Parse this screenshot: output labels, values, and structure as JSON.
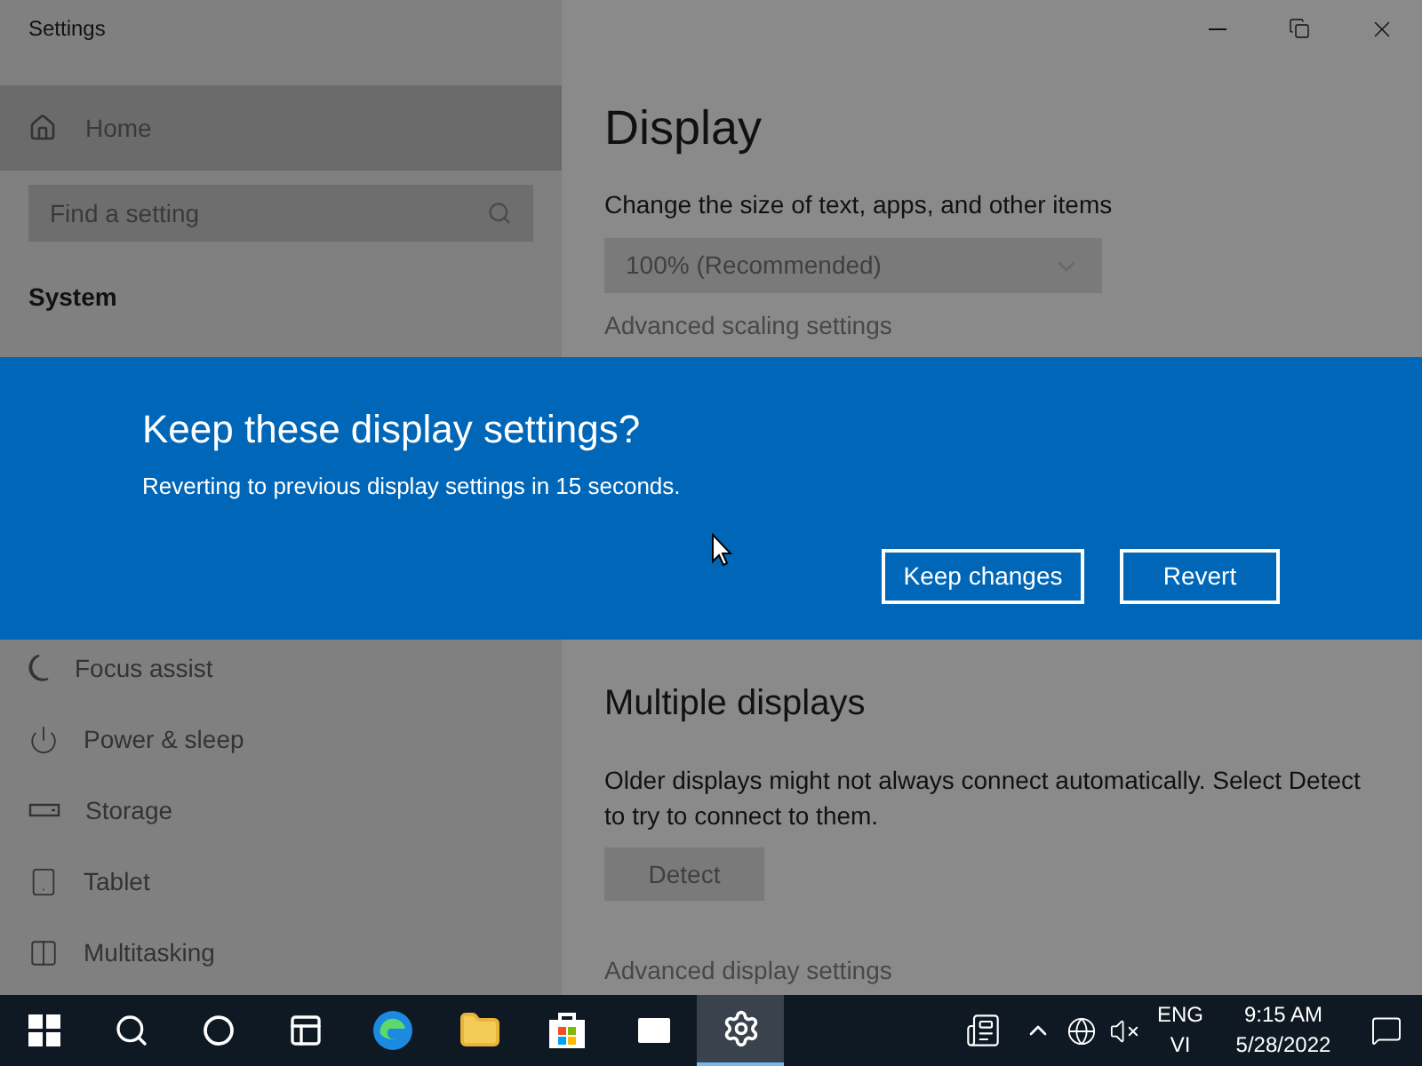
{
  "window": {
    "title": "Settings"
  },
  "sidebar": {
    "home": "Home",
    "search": {
      "placeholder": "Find a setting"
    },
    "section": "System",
    "items": [
      {
        "label": "Focus assist"
      },
      {
        "label": "Power & sleep"
      },
      {
        "label": "Storage"
      },
      {
        "label": "Tablet"
      },
      {
        "label": "Multitasking"
      }
    ]
  },
  "content": {
    "title": "Display",
    "scale_label": "Change the size of text, apps, and other items",
    "scale_value": "100% (Recommended)",
    "scaling_link": "Advanced scaling settings",
    "multi_title": "Multiple displays",
    "multi_text": "Older displays might not always connect automatically. Select Detect to try to connect to them.",
    "detect_button": "Detect",
    "advanced_link": "Advanced display settings"
  },
  "dialog": {
    "title": "Keep these display settings?",
    "message": "Reverting to previous display settings in 15 seconds.",
    "buttons": [
      "Keep changes",
      "Revert"
    ]
  },
  "taskbar": {
    "apps": [
      {
        "selected": false
      },
      {
        "selected": false
      },
      {
        "selected": false
      },
      {
        "selected": false
      },
      {
        "selected": false
      },
      {
        "selected": false
      },
      {
        "selected": false
      },
      {
        "selected": false
      },
      {
        "selected": true
      }
    ],
    "language": [
      "ENG",
      "VI"
    ],
    "time": "9:15 AM",
    "date": "5/28/2022"
  }
}
